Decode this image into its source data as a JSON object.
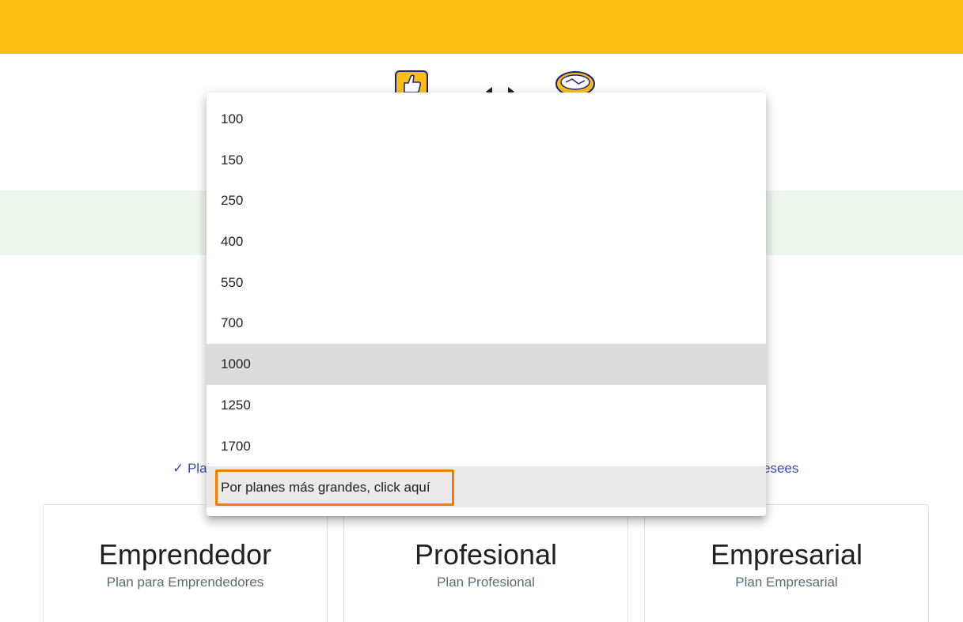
{
  "brand": {
    "accent_color": "#fbbf14",
    "band_color": "#edf6ec",
    "link_color": "#3949ab",
    "logos": [
      "thumbs-up-icon",
      "exchange-arrows-icon",
      "handshake-icon"
    ]
  },
  "features": {
    "left_partial": "✓ Pla",
    "right_partial": "esees"
  },
  "dropdown": {
    "options": [
      "100",
      "150",
      "250",
      "400",
      "550",
      "700",
      "1000",
      "1250",
      "1700"
    ],
    "selected": "1000",
    "more_link": "Por planes más grandes, click aquí",
    "highlight_color": "#f57c00"
  },
  "plans": [
    {
      "title": "Emprendedor",
      "subtitle": "Plan para Emprendedores"
    },
    {
      "title": "Profesional",
      "subtitle": "Plan Profesional"
    },
    {
      "title": "Empresarial",
      "subtitle": "Plan Empresarial"
    }
  ]
}
